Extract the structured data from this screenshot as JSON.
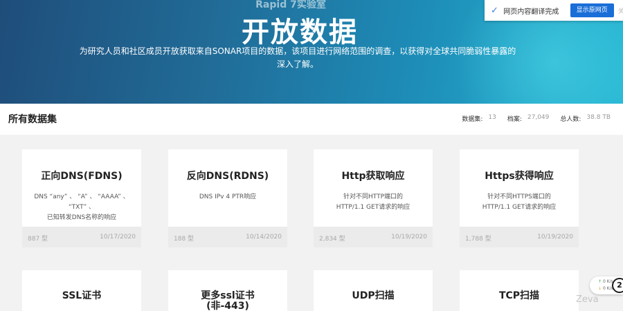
{
  "hero": {
    "kicker": "Rapid 7实验室",
    "title": "开放数据",
    "description": "为研究人员和社区成员开放获取来自SONAR项目的数据，该项目进行网络范围的调查，以获得对全球共同脆弱性暴露的深入了解。"
  },
  "translate_bar": {
    "message": "网页内容翻译完成",
    "button": "显示原网页",
    "more": "关"
  },
  "datasets": {
    "heading": "所有数据集",
    "stats": [
      {
        "label": "数据集:",
        "value": "13"
      },
      {
        "label": "档案:",
        "value": "27,049"
      },
      {
        "label": "总人数:",
        "value": "38.8 TB"
      }
    ],
    "cards": [
      {
        "title": "正向DNS(FDNS)",
        "desc": "DNS “any” 、 “A” 、 “AAAA” 、 “TXT” 、\n已知转发DNS名称的响应",
        "count": "887 型",
        "date": "10/17/2020"
      },
      {
        "title": "反向DNS(RDNS)",
        "desc": "DNS IPv 4 PTR响应",
        "count": "188 型",
        "date": "10/14/2020"
      },
      {
        "title": "Http获取响应",
        "desc": "针对不同HTTP端口的\nHTTP/1.1 GET请求的响应",
        "count": "2,834 型",
        "date": "10/19/2020"
      },
      {
        "title": "Https获得响应",
        "desc": "针对不同HTTPS端口的\nHTTP/1.1 GET请求的响应",
        "count": "1,788 型",
        "date": "10/19/2020"
      }
    ],
    "cards_row2": [
      {
        "title": "SSL证书"
      },
      {
        "title": "更多ssl证书\n(非-443)"
      },
      {
        "title": "UDP扫描"
      },
      {
        "title": "TCP扫描"
      }
    ]
  },
  "net_widget": {
    "up": "0 K/s",
    "down": "0 K/s",
    "badge": "2"
  },
  "watermark": "Zeva",
  "colors": {
    "hero_start": "#1f4d7a",
    "hero_end": "#27b6d3",
    "translate_button": "#1a6ed8"
  }
}
